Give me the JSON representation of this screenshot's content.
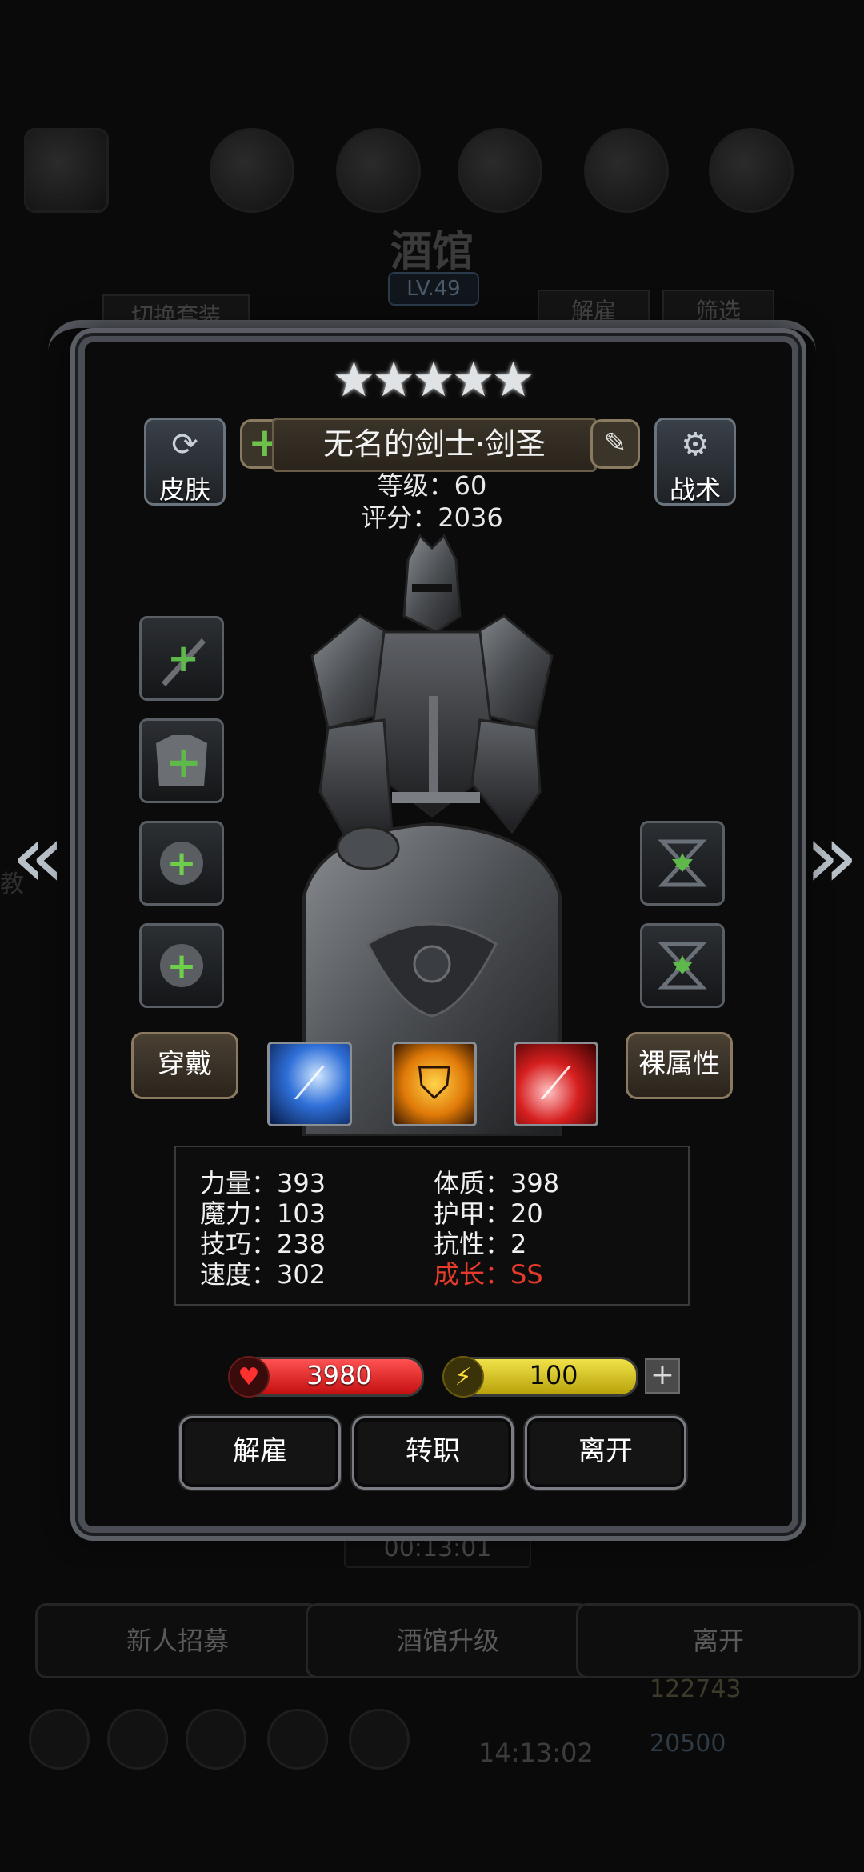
{
  "background": {
    "title": "酒馆",
    "level": "LV.49",
    "switch_outfit": "切换套装",
    "dismiss": "解雇",
    "filter": "筛选",
    "timer": "00:13:01",
    "bottom_buttons": [
      "新人招募",
      "酒馆升级",
      "离开"
    ],
    "gold": "122743",
    "gems": "20500",
    "clock": "14:13:02",
    "side_letter": "教"
  },
  "hero": {
    "stars": "★★★★★",
    "star_count": 5,
    "name": "无名的剑士·剑圣",
    "level_line": "等级：60",
    "score_line": "评分：2036",
    "skin_label": "皮肤",
    "tactic_label": "战术",
    "wear_label": "穿戴",
    "bare_label": "裸属性"
  },
  "stats": {
    "strength": "力量：393",
    "magic": "魔力：103",
    "skill": "技巧：238",
    "speed": "速度：302",
    "constitution": "体质：398",
    "armor": "护甲：20",
    "resistance": "抗性：2",
    "growth": "成长：SS"
  },
  "bars": {
    "hp": "3980",
    "mp": "100",
    "plus": "+"
  },
  "actions": {
    "dismiss": "解雇",
    "change_job": "转职",
    "leave": "离开"
  },
  "colors": {
    "growth": "#e63a2a",
    "hp": "#d41a1a",
    "mp": "#d8c420",
    "equip_plus": "#5fb84a"
  }
}
